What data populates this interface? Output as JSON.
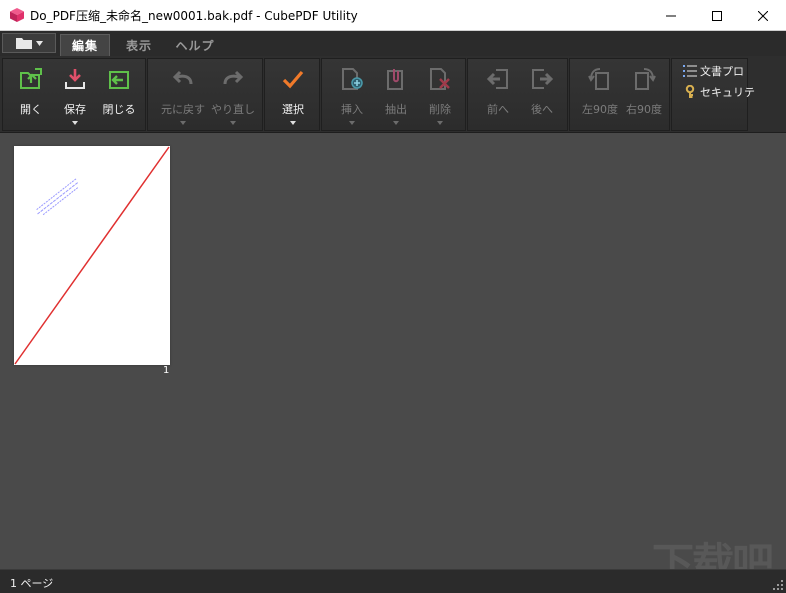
{
  "window": {
    "title": "Do_PDF压缩_未命名_new0001.bak.pdf - CubePDF Utility",
    "controls": [
      "minimize-icon",
      "maximize-icon",
      "close-icon"
    ]
  },
  "tabs": [
    {
      "label": "編集",
      "active": true
    },
    {
      "label": "表示",
      "active": false
    },
    {
      "label": "ヘルプ",
      "active": false
    }
  ],
  "ribbon": {
    "open": "開く",
    "save": "保存",
    "close": "閉じる",
    "undo": "元に戻す",
    "redo": "やり直し",
    "select": "選択",
    "insert": "挿入",
    "extract": "抽出",
    "delete": "削除",
    "move_prev": "前へ",
    "move_next": "後へ",
    "rotate_left": "左90度",
    "rotate_right": "右90度",
    "metadata": "文書プロ",
    "security": "セキュリテ"
  },
  "workspace": {
    "page_number": "1"
  },
  "status": {
    "page_count": "1 ページ"
  },
  "colors": {
    "accent_green": "#5fc04a",
    "accent_orange": "#f07a2a",
    "accent_red_icon": "#e0506a",
    "disabled": "#6c6c6c"
  }
}
